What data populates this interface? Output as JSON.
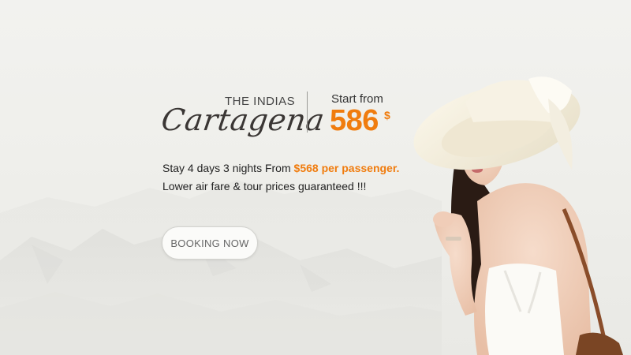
{
  "banner": {
    "subtitle": "THE INDIAS",
    "title": "Cartagena",
    "start_label": "Start from",
    "price": "586",
    "currency": "$",
    "desc_prefix": "Stay 4 days 3 nights From ",
    "desc_highlight": "$568 per passenger.",
    "desc_line2": "Lower air fare & tour prices guaranteed !!!",
    "cta_label": "BOOKING NOW"
  },
  "colors": {
    "accent": "#f07c0e",
    "text": "#222222",
    "background": "#f0f0ec"
  },
  "icons": {
    "model": "woman-in-sun-hat-photo"
  }
}
